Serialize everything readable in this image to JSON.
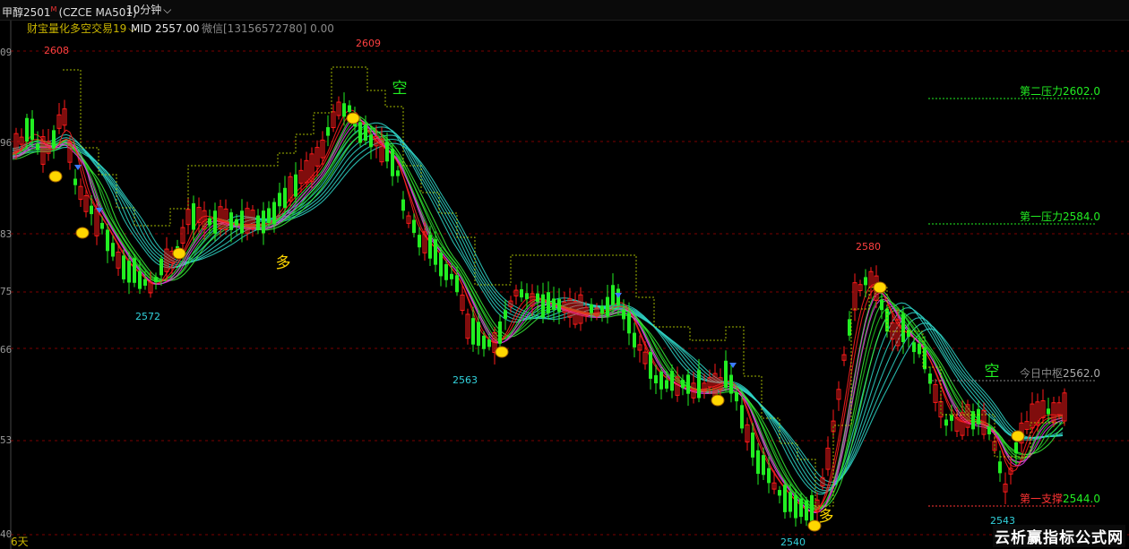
{
  "header": {
    "symbol": "甲醇2501",
    "main_mark": "M",
    "code": "(CZCE MA501)",
    "timeframe": "10分钟"
  },
  "indicator": {
    "name": "财宝量化多空交易19",
    "mid": "MID 2557.00",
    "contact": "微信[13156572780] 0.00"
  },
  "y_ticks": [
    "09",
    "96",
    "83",
    "75",
    "66",
    "53",
    "40"
  ],
  "levels": [
    {
      "label": "第二压力",
      "value": "2602.0"
    },
    {
      "label": "第一压力",
      "value": "2584.0"
    },
    {
      "label": "今日中枢",
      "value": "2562.0"
    },
    {
      "label": "第一支撑",
      "value": "2544.0"
    }
  ],
  "price_labels": [
    "2608",
    "2609",
    "2572",
    "2563",
    "2580",
    "2540",
    "2543"
  ],
  "signal_labels": {
    "long": "多",
    "short": "空"
  },
  "bottom_left": "6天",
  "watermark": "云析赢指标公式网",
  "colors": {
    "up": "#ff1a1a",
    "down": "#22ee22",
    "cyan": "#32d2dc",
    "gold": "#ffd700"
  }
}
